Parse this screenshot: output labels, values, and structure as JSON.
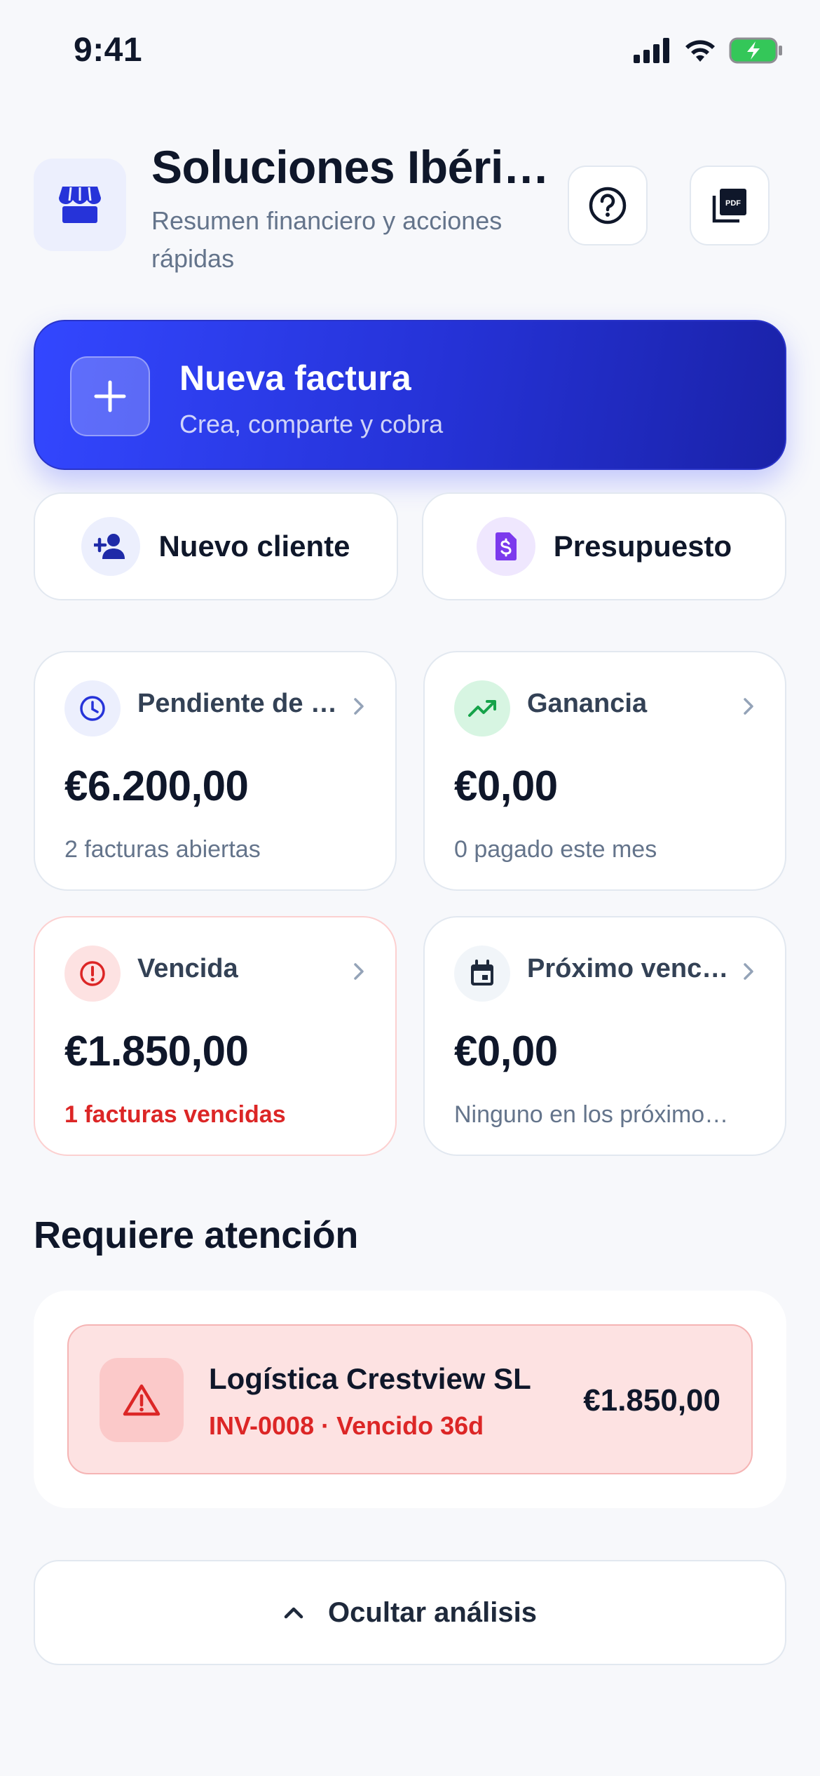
{
  "status_bar": {
    "time": "9:41",
    "icons": [
      "signal-icon",
      "wifi-icon",
      "battery-charging-icon"
    ]
  },
  "header": {
    "company_name": "Soluciones Ibéri…",
    "subtitle": "Resumen financiero y acciones rápidas",
    "logo_icon": "store-icon",
    "help_icon": "help-circle-icon",
    "pdf_icon": "pdf-icon"
  },
  "primary_action": {
    "title": "Nueva factura",
    "subtitle": "Crea, comparte y cobra",
    "icon": "plus-icon"
  },
  "secondary_actions": [
    {
      "label": "Nuevo cliente",
      "icon": "person-add-icon"
    },
    {
      "label": "Presupuesto",
      "icon": "document-dollar-icon"
    }
  ],
  "stats": [
    {
      "label": "Pendiente de …",
      "value": "€6.200,00",
      "note": "2 facturas abiertas",
      "icon": "clock-icon"
    },
    {
      "label": "Ganancia",
      "value": "€0,00",
      "note": "0 pagado este mes",
      "icon": "trending-up-icon"
    },
    {
      "label": "Vencida",
      "value": "€1.850,00",
      "note": "1 facturas vencidas",
      "icon": "alert-circle-icon"
    },
    {
      "label": "Próximo venc…",
      "value": "€0,00",
      "note": "Ninguno en los próximo…",
      "icon": "calendar-icon"
    }
  ],
  "attention": {
    "title": "Requiere atención",
    "items": [
      {
        "name": "Logística Crestview SL",
        "meta": "INV-0008 · Vencido 36d",
        "amount": "€1.850,00",
        "icon": "warning-icon"
      }
    ]
  },
  "toggle": {
    "label": "Ocultar análisis",
    "icon": "chevron-up-icon"
  },
  "colors": {
    "accent": "#3347ff",
    "danger": "#dc2626",
    "success": "#16a34a",
    "violet": "#7c3aed"
  }
}
